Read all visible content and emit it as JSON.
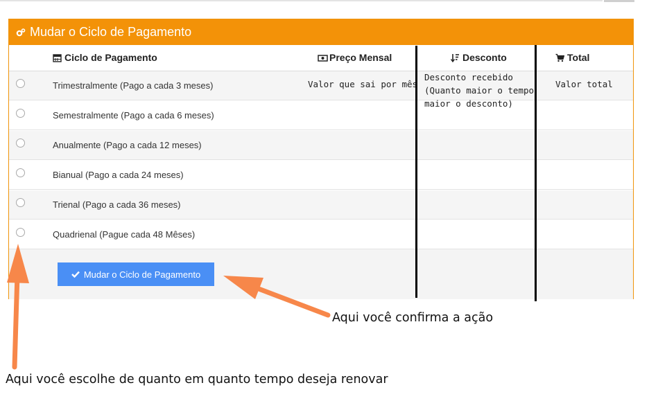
{
  "panel": {
    "title": "Mudar o Ciclo de Pagamento",
    "header_color": "#f39208",
    "icon": "gears-icon"
  },
  "table": {
    "columns": [
      {
        "label": "Ciclo de Pagamento",
        "icon": "calendar-icon"
      },
      {
        "label": "Preço Mensal",
        "icon": "money-icon"
      },
      {
        "label": "Desconto",
        "icon": "sort-amount-icon"
      },
      {
        "label": "Total",
        "icon": "cart-icon"
      }
    ],
    "rows": [
      {
        "label": "Trimestralmente (Pago a cada 3 meses)",
        "selected": false
      },
      {
        "label": "Semestralmente (Pago a cada 6 meses)",
        "selected": false
      },
      {
        "label": "Anualmente (Pago a cada 12 meses)",
        "selected": false
      },
      {
        "label": "Bianual (Pago a cada 24 meses)",
        "selected": false
      },
      {
        "label": "Trienal (Pago a cada 36 meses)",
        "selected": false
      },
      {
        "label": "Quadrienal (Pague cada 48 Mêses)",
        "selected": false
      }
    ]
  },
  "notes": {
    "monthly_price": "Valor que sai por mês",
    "discount": "Desconto recebido\n(Quanto maior o tempo\nmaior o desconto)",
    "total": "Valor total"
  },
  "submit_button": {
    "label": "Mudar o Ciclo de Pagamento",
    "color": "#4a8ff5",
    "icon": "check-icon"
  },
  "annotations": {
    "confirm": "Aqui você confirma a ação",
    "choose": "Aqui você escolhe de quanto em quanto tempo deseja renovar",
    "arrow_color": "#f7874a"
  }
}
